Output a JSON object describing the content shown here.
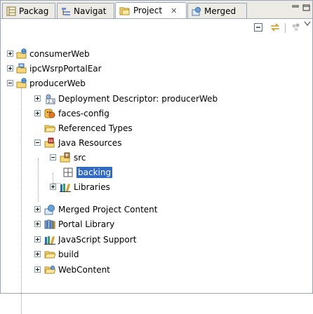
{
  "tabs": [
    {
      "label": "Packag",
      "icon": "package-explorer-icon",
      "active": false
    },
    {
      "label": "Navigat",
      "icon": "navigator-icon",
      "active": false
    },
    {
      "label": "Project",
      "icon": "project-explorer-icon",
      "active": true
    },
    {
      "label": "Merged",
      "icon": "merged-view-icon",
      "active": false
    }
  ],
  "tab_close_glyph": "✕",
  "window_controls": {
    "minimize": "minimize-icon",
    "maximize": "maximize-icon"
  },
  "toolbar": {
    "collapse_all": "collapse-all-icon",
    "link_with_editor": "link-with-editor-icon",
    "filters": "filters-icon",
    "view_menu": "view-menu-icon"
  },
  "tree": [
    {
      "label": "consumerWeb",
      "icon": "web-project-icon",
      "level": 0,
      "expander": "plus"
    },
    {
      "label": "ipcWsrpPortalEar",
      "icon": "ear-project-icon",
      "level": 0,
      "expander": "plus"
    },
    {
      "label": "producerWeb",
      "icon": "web-project-icon",
      "level": 0,
      "expander": "minus"
    },
    {
      "label": "Deployment Descriptor: producerWeb",
      "icon": "deployment-descriptor-icon",
      "level": 1,
      "expander": "plus"
    },
    {
      "label": "faces-config",
      "icon": "faces-config-icon",
      "level": 1,
      "expander": "plus"
    },
    {
      "label": "Referenced Types",
      "icon": "folder-icon",
      "level": 1,
      "expander": "none"
    },
    {
      "label": "Java Resources",
      "icon": "java-resources-icon",
      "level": 1,
      "expander": "minus"
    },
    {
      "label": "src",
      "icon": "source-folder-icon",
      "level": 2,
      "expander": "minus"
    },
    {
      "label": "backing",
      "icon": "package-icon",
      "level": 3,
      "expander": "none",
      "selected": true
    },
    {
      "label": "Libraries",
      "icon": "libraries-icon",
      "level": 2,
      "expander": "plus"
    },
    {
      "label": "Merged Project Content",
      "icon": "merged-content-icon",
      "level": 1,
      "expander": "plus"
    },
    {
      "label": "Portal Library",
      "icon": "portal-library-icon",
      "level": 1,
      "expander": "plus"
    },
    {
      "label": "JavaScript Support",
      "icon": "javascript-support-icon",
      "level": 1,
      "expander": "plus"
    },
    {
      "label": "build",
      "icon": "folder-icon",
      "level": 1,
      "expander": "plus"
    },
    {
      "label": "WebContent",
      "icon": "web-content-folder-icon",
      "level": 1,
      "expander": "plus"
    }
  ],
  "colors": {
    "selection": "#316ac5",
    "tab_bar": "#ecebe6",
    "border": "#9ba7b7"
  }
}
